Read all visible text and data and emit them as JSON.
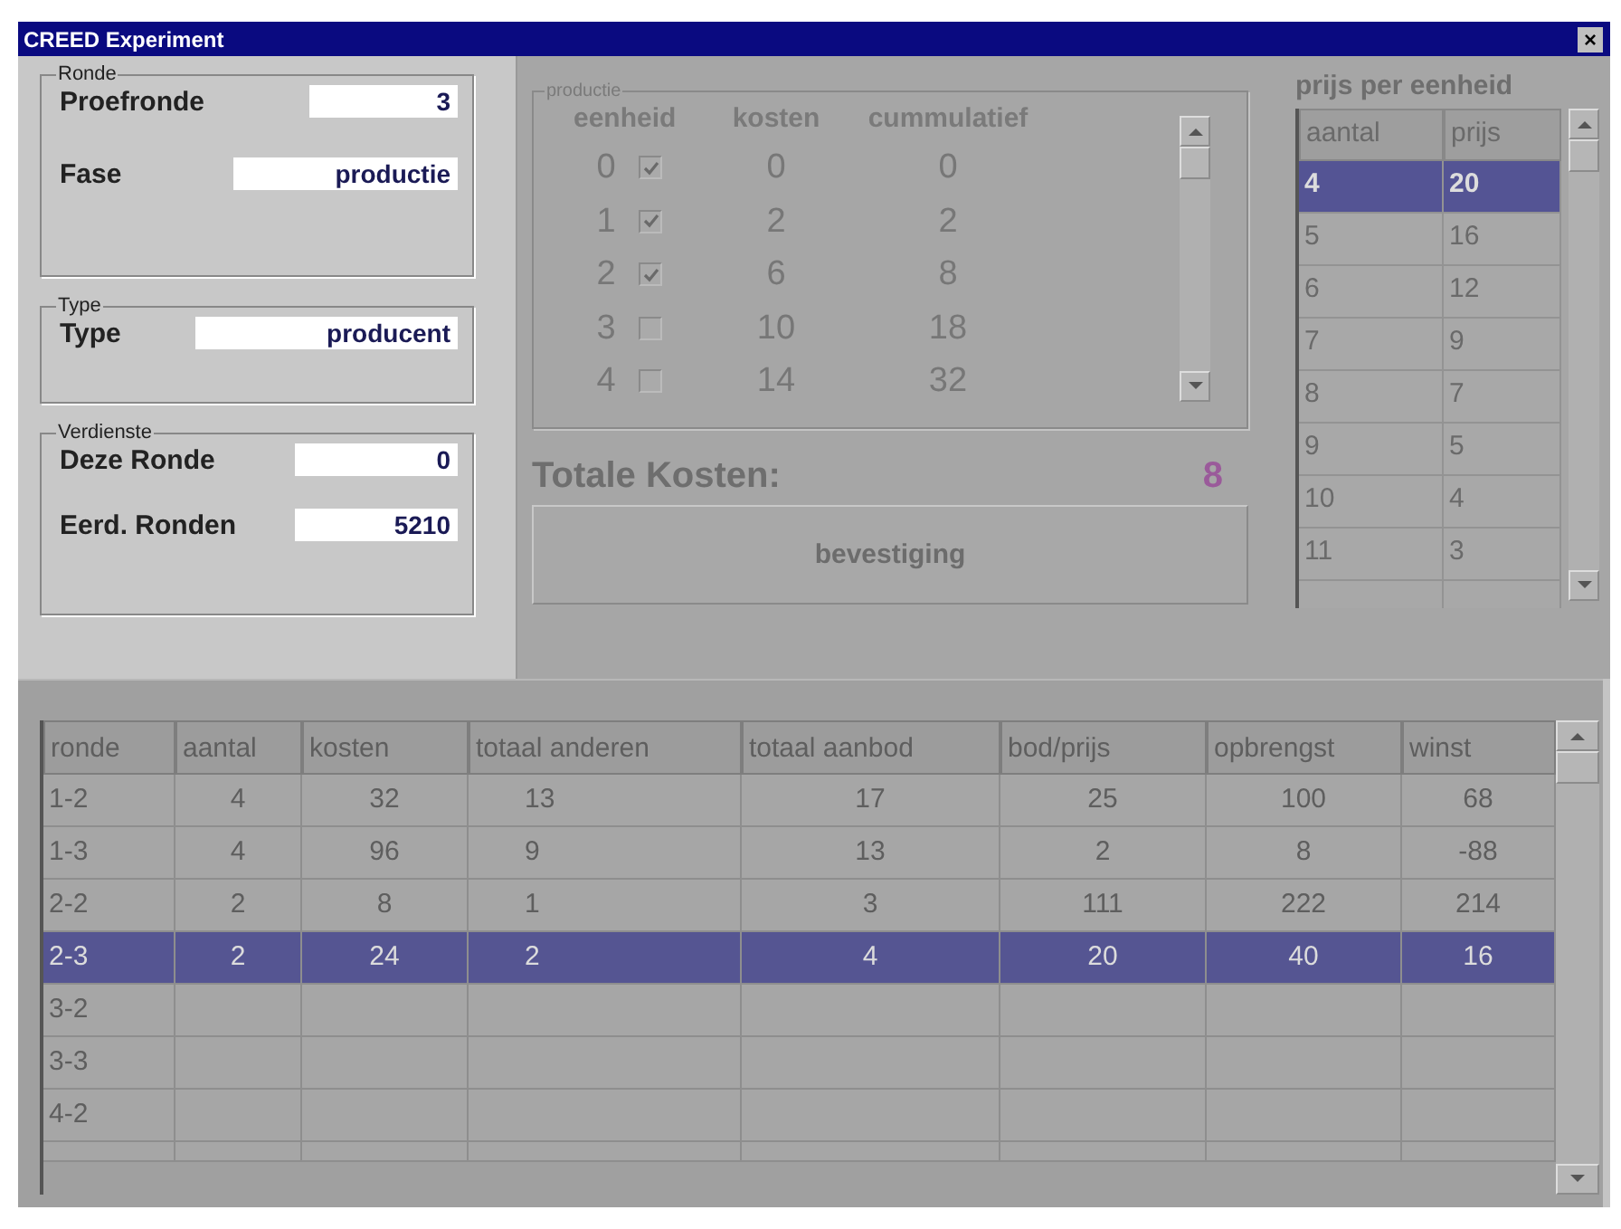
{
  "window": {
    "title": "CREED Experiment",
    "close": "×"
  },
  "ronde": {
    "legend": "Ronde",
    "fields": [
      {
        "label": "Proefronde",
        "value": "3"
      },
      {
        "label": "Fase",
        "value": "productie"
      }
    ]
  },
  "type": {
    "legend": "Type",
    "fields": [
      {
        "label": "Type",
        "value": "producent"
      }
    ]
  },
  "verdienste": {
    "legend": "Verdienste",
    "fields": [
      {
        "label": "Deze Ronde",
        "value": "0"
      },
      {
        "label": "Eerd. Ronden",
        "value": "5210"
      }
    ]
  },
  "productie": {
    "legend": "productie",
    "columns": [
      "eenheid",
      "kosten",
      "cummulatief"
    ],
    "rows": [
      {
        "eenheid": "0",
        "checked": true,
        "kosten": "0",
        "cummulatief": "0"
      },
      {
        "eenheid": "1",
        "checked": true,
        "kosten": "2",
        "cummulatief": "2"
      },
      {
        "eenheid": "2",
        "checked": true,
        "kosten": "6",
        "cummulatief": "8"
      },
      {
        "eenheid": "3",
        "checked": false,
        "kosten": "10",
        "cummulatief": "18"
      },
      {
        "eenheid": "4",
        "checked": false,
        "kosten": "14",
        "cummulatief": "32"
      }
    ]
  },
  "totale_kosten": {
    "label": "Totale Kosten:",
    "value": "8"
  },
  "confirm_button": "bevestiging",
  "prijs_per_eenheid": {
    "title": "prijs per eenheid",
    "columns": [
      "aantal",
      "prijs"
    ],
    "rows": [
      {
        "cells": [
          "4",
          "20"
        ],
        "selected": true
      },
      {
        "cells": [
          "5",
          "16"
        ],
        "selected": false
      },
      {
        "cells": [
          "6",
          "12"
        ],
        "selected": false
      },
      {
        "cells": [
          "7",
          "9"
        ],
        "selected": false
      },
      {
        "cells": [
          "8",
          "7"
        ],
        "selected": false
      },
      {
        "cells": [
          "9",
          "5"
        ],
        "selected": false
      },
      {
        "cells": [
          "10",
          "4"
        ],
        "selected": false
      },
      {
        "cells": [
          "11",
          "3"
        ],
        "selected": false
      }
    ]
  },
  "table": {
    "columns": [
      "ronde",
      "aantal",
      "kosten",
      "totaal anderen",
      "totaal aanbod",
      "bod/prijs",
      "opbrengst",
      "winst"
    ],
    "rows": [
      {
        "cells": [
          "1-2",
          "4",
          "32",
          "13",
          "17",
          "25",
          "100",
          "68"
        ],
        "selected": false
      },
      {
        "cells": [
          "1-3",
          "4",
          "96",
          "9",
          "13",
          "2",
          "8",
          "-88"
        ],
        "selected": false
      },
      {
        "cells": [
          "2-2",
          "2",
          "8",
          "1",
          "3",
          "111",
          "222",
          "214"
        ],
        "selected": false
      },
      {
        "cells": [
          "2-3",
          "2",
          "24",
          "2",
          "4",
          "20",
          "40",
          "16"
        ],
        "selected": true
      },
      {
        "cells": [
          "3-2"
        ],
        "selected": false
      },
      {
        "cells": [
          "3-3"
        ],
        "selected": false
      },
      {
        "cells": [
          "4-2"
        ],
        "selected": false
      }
    ]
  }
}
